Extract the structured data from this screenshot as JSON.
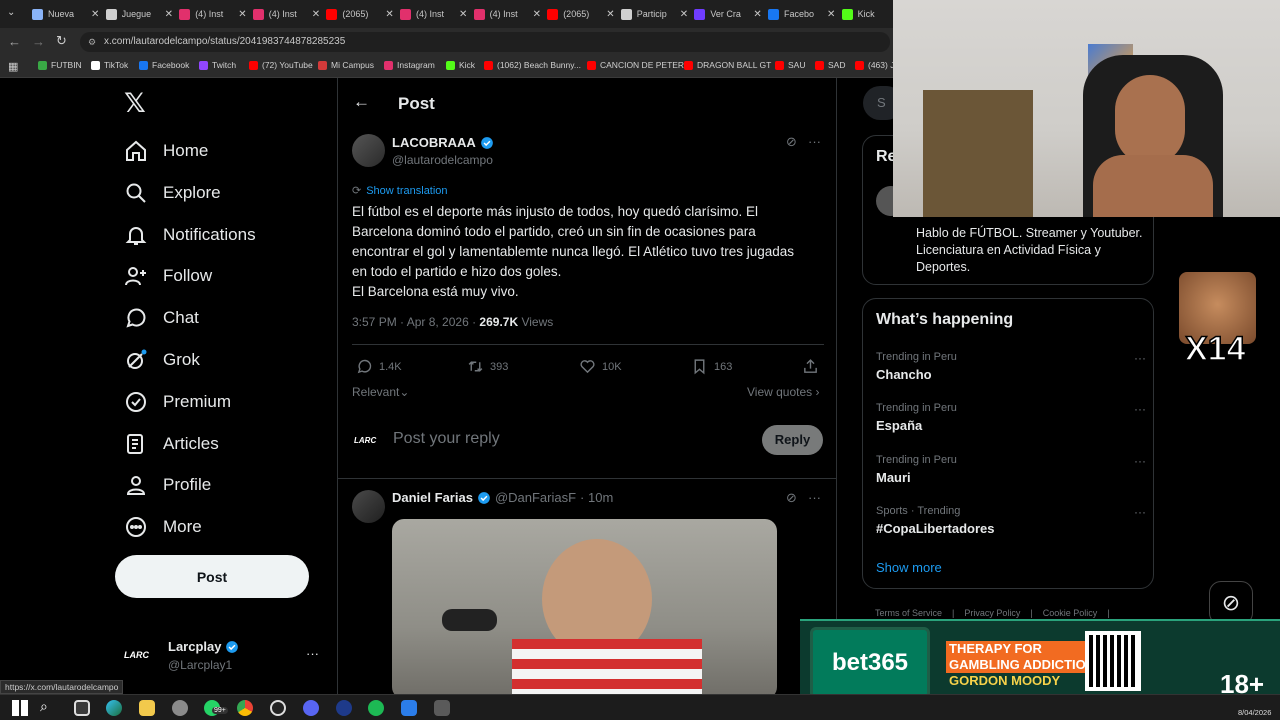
{
  "browser": {
    "tabs": [
      {
        "label": "Nueva",
        "color": "#8ab4f8"
      },
      {
        "label": "Juegue",
        "color": "#cfcfcf"
      },
      {
        "label": "(4) Inst",
        "color": "#e1306c"
      },
      {
        "label": "(4) Inst",
        "color": "#e1306c"
      },
      {
        "label": "(2065)",
        "color": "#ff0000"
      },
      {
        "label": "(4) Inst",
        "color": "#e1306c"
      },
      {
        "label": "(4) Inst",
        "color": "#e1306c"
      },
      {
        "label": "(2065)",
        "color": "#ff0000"
      },
      {
        "label": "Particip",
        "color": "#cfcfcf"
      },
      {
        "label": "Ver Cra",
        "color": "#6f3cff"
      },
      {
        "label": "Facebo",
        "color": "#1877f2"
      },
      {
        "label": "Kick",
        "color": "#53fc18"
      }
    ],
    "url": "x.com/lautarodelcampo/status/2041983744878285235",
    "bookmarks": [
      {
        "label": "FUTBIN",
        "color": "#39a845"
      },
      {
        "label": "TikTok",
        "color": "#ffffff"
      },
      {
        "label": "Facebook",
        "color": "#1877f2"
      },
      {
        "label": "Twitch",
        "color": "#9146ff"
      },
      {
        "label": "(72) YouTube",
        "color": "#ff0000"
      },
      {
        "label": "Mi Campus",
        "color": "#d43a3a"
      },
      {
        "label": "Instagram",
        "color": "#e1306c"
      },
      {
        "label": "Kick",
        "color": "#53fc18"
      },
      {
        "label": "(1062) Beach Bunny...",
        "color": "#ff0000"
      },
      {
        "label": "CANCION DE PETER",
        "color": "#ff0000"
      },
      {
        "label": "DRAGON BALL GT",
        "color": "#ff0000"
      },
      {
        "label": "SAU",
        "color": "#ff0000"
      },
      {
        "label": "SAD",
        "color": "#ff0000"
      },
      {
        "label": "(463) J",
        "color": "#ff0000"
      }
    ],
    "status_url": "https://x.com/lautarodelcampo"
  },
  "nav": {
    "logo": "𝕏",
    "items": [
      "Home",
      "Explore",
      "Notifications",
      "Follow",
      "Chat",
      "Grok",
      "Premium",
      "Articles",
      "Profile",
      "More"
    ],
    "post_label": "Post",
    "account_name": "Larcplay",
    "account_handle": "@Larcplay1",
    "more_dots": "···"
  },
  "main": {
    "header_title": "Post",
    "tweet": {
      "author": "LACOBRAAA",
      "handle": "@lautarodelcampo",
      "show_translation": "Show translation",
      "lines": [
        "El fútbol es el deporte más injusto de todos, hoy quedó clarísimo. El",
        "Barcelona dominó todo el partido, creó un sin fin de ocasiones para",
        "encontrar el gol y lamentablemte nunca llegó. El Atlético tuvo tres jugadas",
        "en todo el partido e hizo dos goles.",
        "El Barcelona está muy vivo."
      ],
      "time": "3:57 PM · Apr 8, 2026 ·",
      "views_count": "269.7K",
      "views_label": "Views",
      "replies": "1.4K",
      "reposts": "393",
      "likes": "10K",
      "bookmarks": "163"
    },
    "relevant_label": "Relevant",
    "view_quotes": "View quotes",
    "reply_placeholder": "Post your reply",
    "reply_button": "Reply",
    "reply_tweet": {
      "author": "Daniel Farias",
      "handle": "@DanFariasF",
      "time": "· 10m"
    }
  },
  "right": {
    "search_letter": "S",
    "relevant_title": "Re",
    "bio": [
      "Hablo de FÚTBOL. Streamer y Youtuber.",
      "Licenciatura en Actividad Física y",
      "Deportes."
    ],
    "happening_title": "What’s happening",
    "trends": [
      {
        "category": "Trending in Peru",
        "name": "Chancho"
      },
      {
        "category": "Trending in Peru",
        "name": "España"
      },
      {
        "category": "Trending in Peru",
        "name": "Mauri"
      },
      {
        "category": "Sports · Trending",
        "name": "#CopaLibertadores"
      }
    ],
    "show_more": "Show more",
    "footer_links": [
      "Terms of Service",
      "Privacy Policy",
      "Cookie Policy"
    ]
  },
  "overlay": {
    "counter": "x14",
    "ad_brand": "bet365",
    "ad_line1": "THERAPY FOR",
    "ad_line2": "GAMBLING ADDICTION",
    "ad_line3": "GORDON MOODY",
    "ad_age": "18+",
    "date": "8/04/2026"
  },
  "taskbar": {
    "badge": "99+"
  },
  "colors": {
    "x_blue": "#1d9bf0",
    "bet365_green": "#027b5b",
    "ad_orange": "#f26b21"
  }
}
